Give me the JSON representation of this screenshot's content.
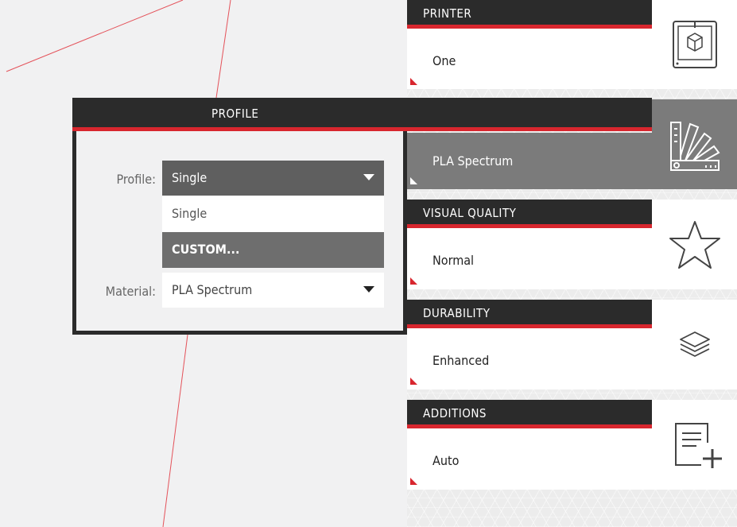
{
  "profile_panel": {
    "title": "PROFILE",
    "profile_label": "Profile:",
    "profile_value": "Single",
    "profile_options": [
      "Single",
      "CUSTOM..."
    ],
    "material_label": "Material:",
    "material_value": "PLA Spectrum"
  },
  "sections": {
    "printer": {
      "title": "PRINTER",
      "value": "One",
      "icon": "printer-icon"
    },
    "profile": {
      "value": "PLA Spectrum",
      "icon": "swatch-fan-icon"
    },
    "visual_quality": {
      "title": "VISUAL QUALITY",
      "value": "Normal",
      "icon": "star-icon"
    },
    "durability": {
      "title": "DURABILITY",
      "value": "Enhanced",
      "icon": "layers-icon"
    },
    "additions": {
      "title": "ADDITIONS",
      "value": "Auto",
      "icon": "add-document-icon"
    }
  },
  "colors": {
    "accent": "#d8262e",
    "header": "#2b2b2b",
    "active": "#7b7b7b"
  }
}
